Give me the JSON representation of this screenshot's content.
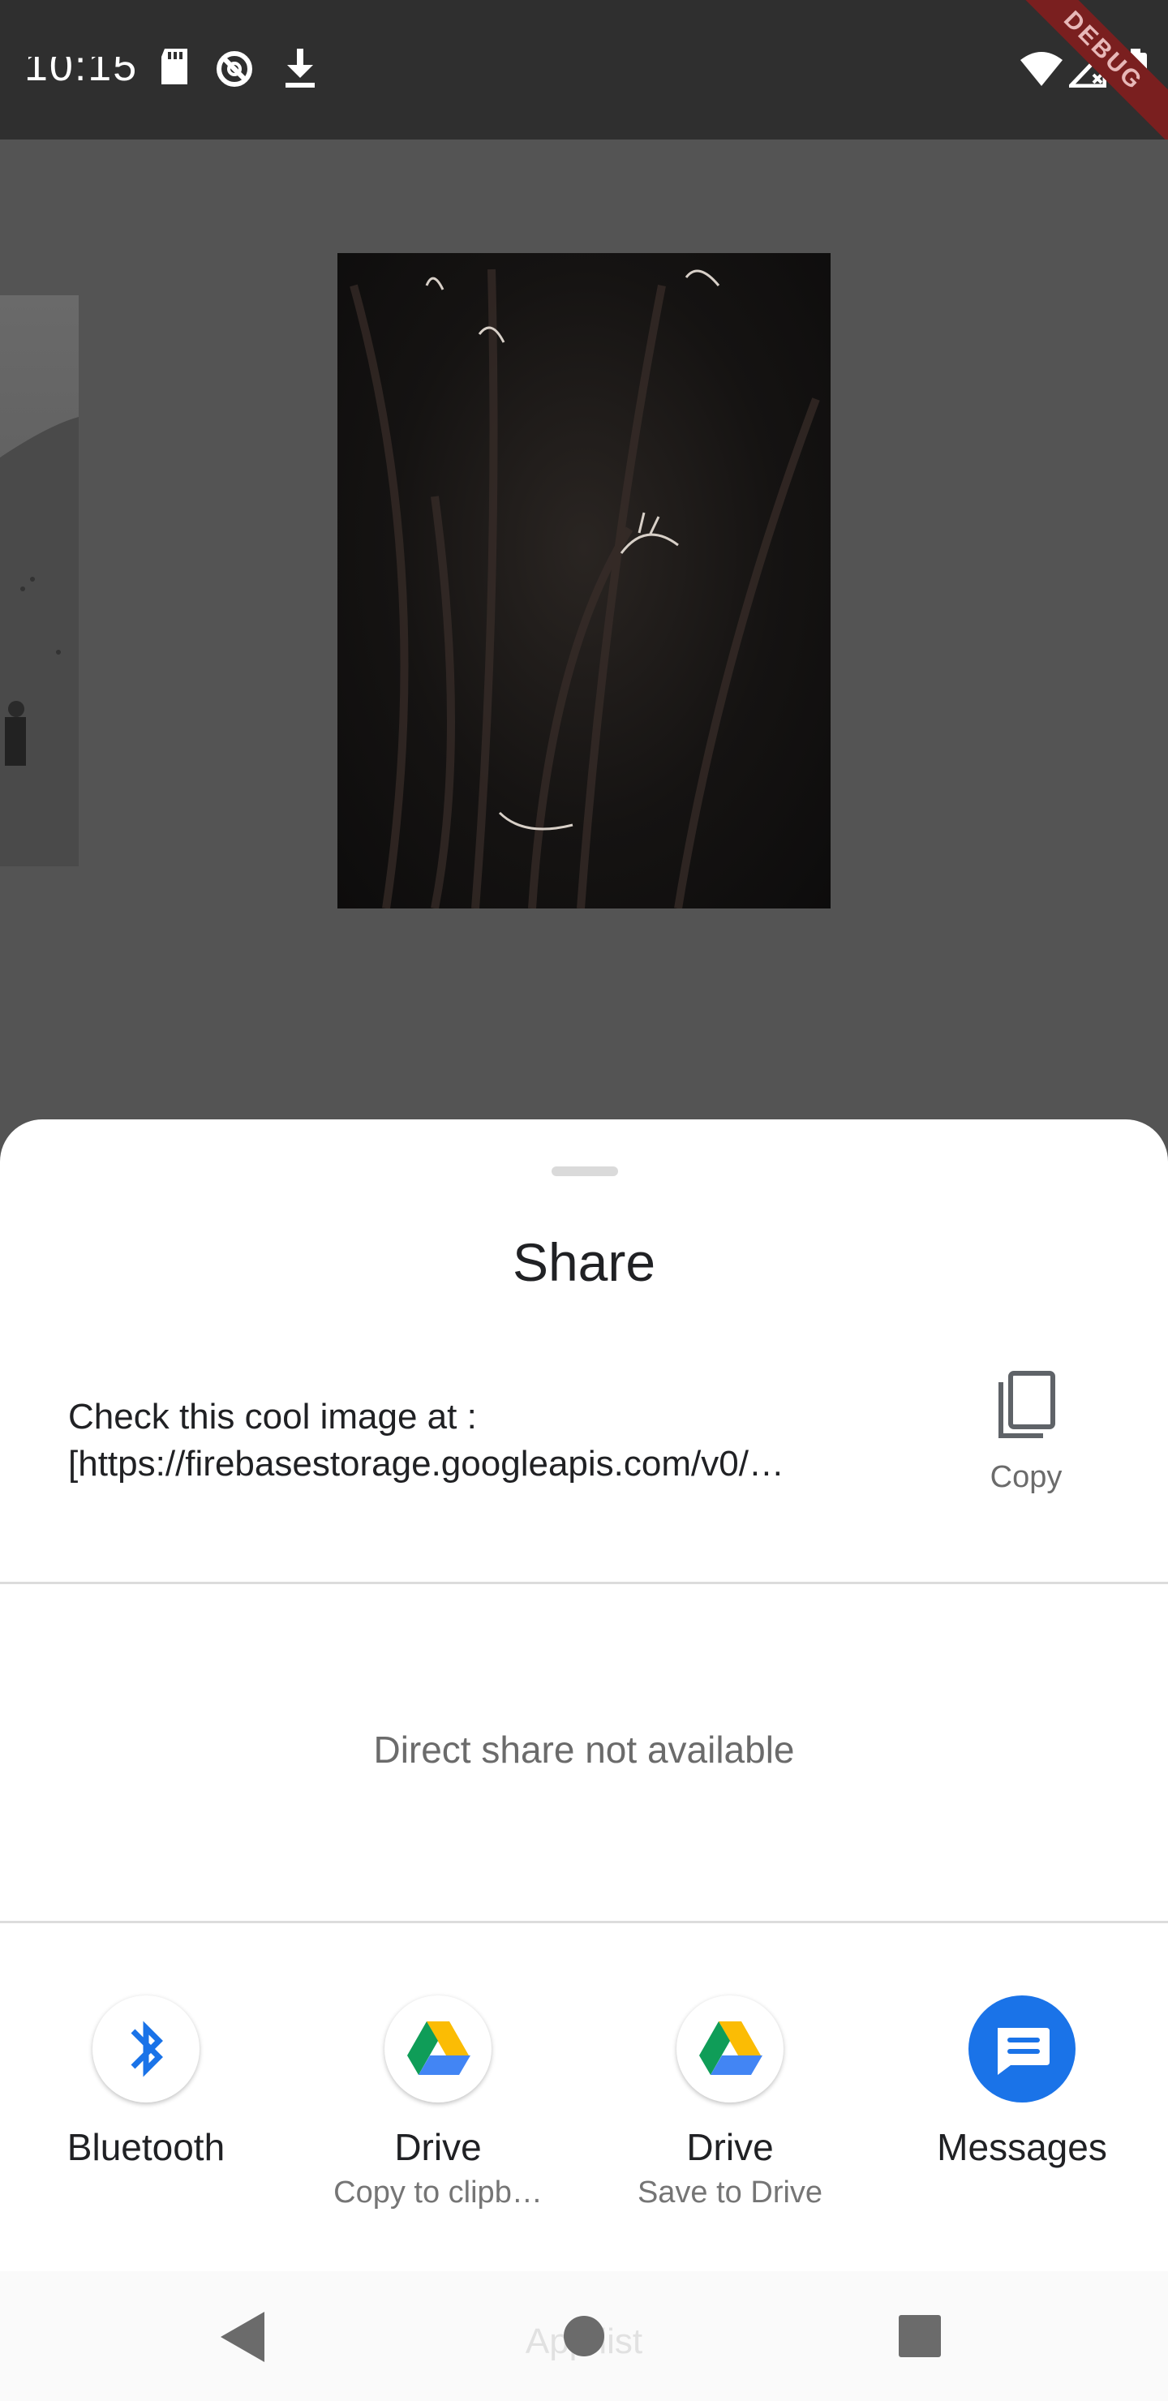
{
  "status_bar": {
    "time": "10:15",
    "icons": [
      "sd-card-icon",
      "no-sync-icon",
      "download-icon",
      "wifi-icon",
      "no-signal-icon",
      "battery-icon"
    ],
    "debug_label": "DEBUG"
  },
  "gallery": {
    "images": [
      "side-image",
      "main-image"
    ]
  },
  "share_sheet": {
    "title": "Share",
    "share_text_line1": "Check this cool image at :",
    "share_text_line2": "[https://firebasestorage.googleapis.com/v0/…",
    "copy_label": "Copy",
    "direct_share_message": "Direct share not available",
    "targets": [
      {
        "label": "Bluetooth",
        "sub": "",
        "icon": "bluetooth-icon"
      },
      {
        "label": "Drive",
        "sub": "Copy to clipb…",
        "icon": "google-drive-icon"
      },
      {
        "label": "Drive",
        "sub": "Save to Drive",
        "icon": "google-drive-icon"
      },
      {
        "label": "Messages",
        "sub": "",
        "icon": "messages-icon"
      }
    ]
  },
  "nav_bar": {
    "ghost_text": "App list",
    "buttons": [
      "back-icon",
      "home-icon",
      "recents-icon"
    ]
  },
  "colors": {
    "scrim": "#545454",
    "status_bar": "#2f2f2f",
    "sheet": "#ffffff",
    "bluetooth": "#1a73e8",
    "messages": "#1a73e8"
  }
}
